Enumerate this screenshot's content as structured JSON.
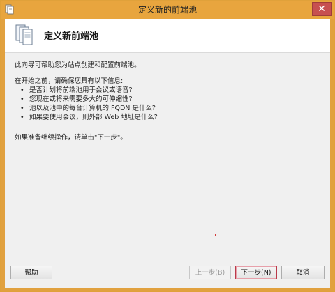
{
  "window": {
    "title": "定义新的前端池",
    "close_label": "✕"
  },
  "header": {
    "title": "定义新前端池",
    "icon": "server-pool-icon"
  },
  "content": {
    "intro": "此向导可帮助您为站点创建和配置前端池。",
    "before_heading": "在开始之前，请确保您具有以下信息:",
    "requirements": [
      "是否计划将前端池用于会议或语音?",
      "您现在或将来需要多大的可伸缩性?",
      "池以及池中的每台计算机的 FQDN 是什么?",
      "如果要使用会议，则外部 Web 地址是什么?"
    ],
    "proceed": "如果准备继续操作，请单击\"下一步\"。"
  },
  "buttons": {
    "help": "帮助",
    "prev": "上一步(B)",
    "next": "下一步(N)",
    "cancel": "取消"
  },
  "colors": {
    "frame": "#e8a53e",
    "close": "#c75050",
    "client_bg": "#f0f0f0",
    "next_border": "#b93a4a"
  }
}
